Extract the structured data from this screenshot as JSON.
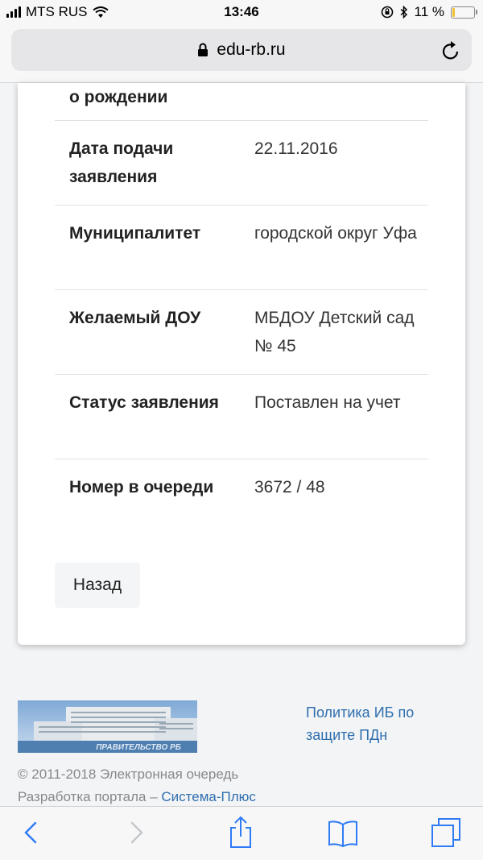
{
  "status_bar": {
    "carrier": "MTS RUS",
    "time": "13:46",
    "battery": "11 %",
    "battery_level": 0.11,
    "battery_color": "#f3c02e"
  },
  "browser": {
    "url": "edu-rb.ru"
  },
  "card": {
    "partial_label": "о рождении",
    "rows": [
      {
        "label": "Дата подачи заявления",
        "value": "22.11.2016"
      },
      {
        "label": "Муниципалитет",
        "value": "городской округ Уфа"
      },
      {
        "label": "Желаемый ДОУ",
        "value": "МБДОУ Детский сад № 45"
      },
      {
        "label": "Статус заявления",
        "value": "Поставлен на учет"
      },
      {
        "label": "Номер в очереди",
        "value": "3672 / 48"
      }
    ],
    "back_label": "Назад"
  },
  "footer": {
    "logo_text": "ПРАВИТЕЛЬСТВО РБ",
    "policy_link": "Политика ИБ по защите ПДн",
    "copyright": "© 2011-2018 Электронная очередь",
    "dev_prefix": "Разработка портала – ",
    "dev_link": "Система-Плюс",
    "link_color": "#2f6fae"
  },
  "toolbar": {
    "items": [
      "back-icon",
      "forward-icon",
      "share-icon",
      "bookmarks-icon",
      "tabs-icon"
    ]
  }
}
